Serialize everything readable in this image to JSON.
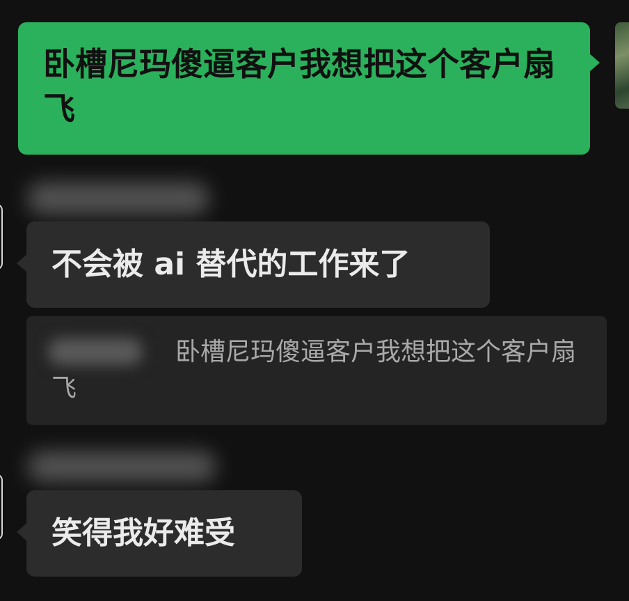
{
  "chat": {
    "outgoing_message": "卧槽尼玛傻逼客户我想把这个客户扇飞",
    "incoming_message_1": "不会被 ai 替代的工作来了",
    "quoted_message": "卧槽尼玛傻逼客户我想把这个客户扇飞",
    "incoming_message_2": "笑得我好难受"
  },
  "colors": {
    "outgoing_bubble": "#2bb15c",
    "incoming_bubble": "#2c2c2c",
    "background": "#111111"
  }
}
